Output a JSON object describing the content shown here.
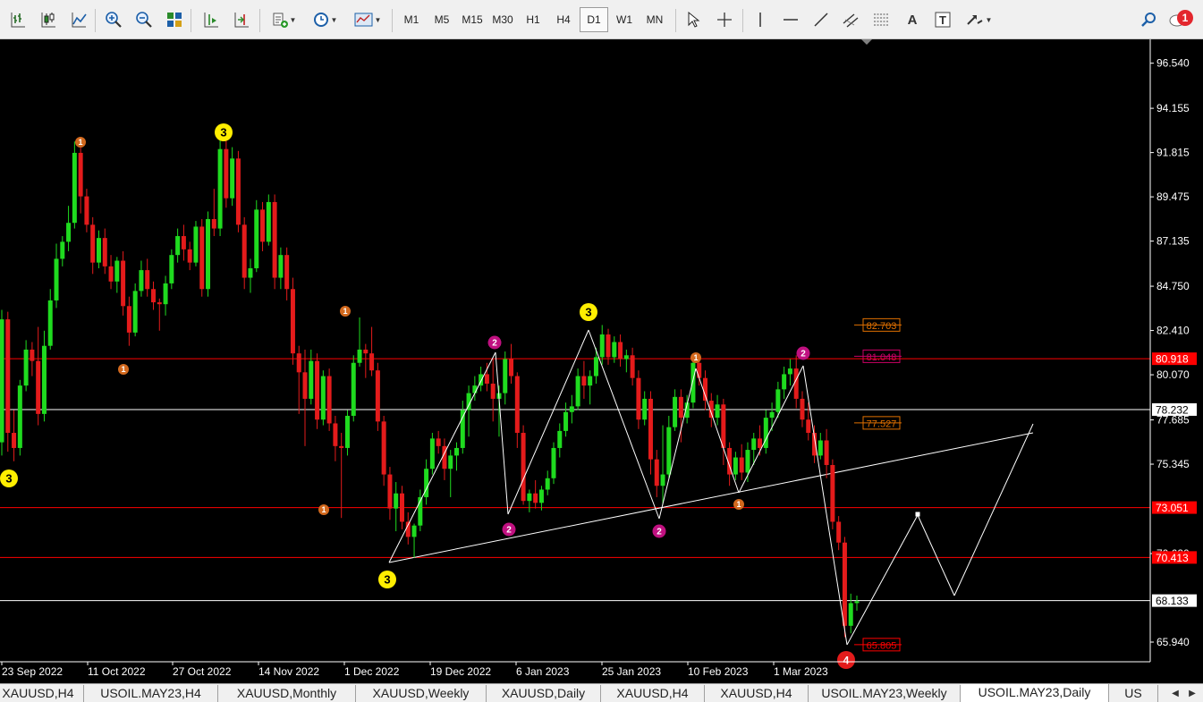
{
  "toolbar": {
    "timeframes": [
      {
        "label": "M1",
        "active": false
      },
      {
        "label": "M5",
        "active": false
      },
      {
        "label": "M15",
        "active": false
      },
      {
        "label": "M30",
        "active": false
      },
      {
        "label": "H1",
        "active": false
      },
      {
        "label": "H4",
        "active": false
      },
      {
        "label": "D1",
        "active": true
      },
      {
        "label": "W1",
        "active": false
      },
      {
        "label": "MN",
        "active": false
      }
    ],
    "notification_count": "1"
  },
  "chart_data": {
    "type": "candlestick",
    "symbol": "USOIL.MAY23",
    "timeframe": "Daily",
    "y_ticks": [
      "96.540",
      "94.155",
      "91.815",
      "89.475",
      "87.135",
      "84.750",
      "82.410",
      "80.070",
      "77.685",
      "75.345",
      "70.620",
      "65.940"
    ],
    "ylim": [
      64.9,
      97.8
    ],
    "x_ticks": [
      "23 Sep 2022",
      "11 Oct 2022",
      "27 Oct 2022",
      "14 Nov 2022",
      "1 Dec 2022",
      "19 Dec 2022",
      "6 Jan 2023",
      "25 Jan 2023",
      "10 Feb 2023",
      "1 Mar 2023"
    ],
    "horizontal_levels": [
      {
        "value": 80.918,
        "label": "80.918",
        "color": "#ff0000"
      },
      {
        "value": 78.232,
        "label": "78.232",
        "color": "#ffffff"
      },
      {
        "value": 73.051,
        "label": "73.051",
        "color": "#ff0000"
      },
      {
        "value": 70.413,
        "label": "70.413",
        "color": "#ff0000"
      },
      {
        "value": 68.133,
        "label": "68.133",
        "color": "#ffffff"
      }
    ],
    "fib_labels": [
      {
        "value": 82.703,
        "label": "82.703",
        "color": "#e07000"
      },
      {
        "value": 81.048,
        "label": "81.048",
        "color": "#cc0066"
      },
      {
        "value": 77.527,
        "label": "77.527",
        "color": "#e07000"
      },
      {
        "value": 65.805,
        "label": "65.805",
        "color": "#ff0000"
      }
    ],
    "wave_labels": [
      {
        "text": "3",
        "style": "big"
      },
      {
        "text": "1",
        "style": "small"
      },
      {
        "text": "3",
        "style": "big"
      },
      {
        "text": "1",
        "style": "small"
      },
      {
        "text": "1",
        "style": "small"
      },
      {
        "text": "1",
        "style": "small"
      },
      {
        "text": "3",
        "style": "big"
      },
      {
        "text": "2",
        "style": "mid"
      },
      {
        "text": "2",
        "style": "mid"
      },
      {
        "text": "3",
        "style": "big"
      },
      {
        "text": "2",
        "style": "mid"
      },
      {
        "text": "1",
        "style": "small"
      },
      {
        "text": "1",
        "style": "small"
      },
      {
        "text": "2",
        "style": "mid"
      },
      {
        "text": "4",
        "style": "red"
      }
    ],
    "candles": [
      {
        "o": 76.5,
        "h": 83.5,
        "l": 75.8,
        "c": 83.0
      },
      {
        "o": 83.0,
        "h": 83.4,
        "l": 76.0,
        "c": 77.0
      },
      {
        "o": 77.0,
        "h": 78.2,
        "l": 75.5,
        "c": 76.2
      },
      {
        "o": 76.2,
        "h": 79.8,
        "l": 75.8,
        "c": 79.5
      },
      {
        "o": 79.5,
        "h": 81.9,
        "l": 79.2,
        "c": 81.4
      },
      {
        "o": 81.4,
        "h": 81.8,
        "l": 80.0,
        "c": 80.8
      },
      {
        "o": 80.8,
        "h": 82.6,
        "l": 77.4,
        "c": 78.0
      },
      {
        "o": 78.0,
        "h": 82.4,
        "l": 77.6,
        "c": 81.6
      },
      {
        "o": 81.6,
        "h": 84.6,
        "l": 81.4,
        "c": 84.0
      },
      {
        "o": 84.0,
        "h": 87.0,
        "l": 83.6,
        "c": 86.2
      },
      {
        "o": 86.2,
        "h": 87.4,
        "l": 85.8,
        "c": 87.1
      },
      {
        "o": 87.1,
        "h": 89.0,
        "l": 86.6,
        "c": 88.1
      },
      {
        "o": 88.1,
        "h": 92.4,
        "l": 87.8,
        "c": 91.8
      },
      {
        "o": 91.8,
        "h": 92.2,
        "l": 88.6,
        "c": 89.5
      },
      {
        "o": 89.5,
        "h": 89.9,
        "l": 87.6,
        "c": 88.0
      },
      {
        "o": 88.0,
        "h": 88.4,
        "l": 85.4,
        "c": 86.0
      },
      {
        "o": 86.0,
        "h": 87.7,
        "l": 85.7,
        "c": 87.3
      },
      {
        "o": 87.3,
        "h": 87.8,
        "l": 85.4,
        "c": 85.8
      },
      {
        "o": 85.8,
        "h": 86.4,
        "l": 84.6,
        "c": 85.0
      },
      {
        "o": 85.0,
        "h": 86.3,
        "l": 84.4,
        "c": 86.1
      },
      {
        "o": 86.1,
        "h": 86.6,
        "l": 83.2,
        "c": 83.7
      },
      {
        "o": 83.7,
        "h": 84.2,
        "l": 81.6,
        "c": 82.3
      },
      {
        "o": 82.3,
        "h": 84.9,
        "l": 82.1,
        "c": 84.5
      },
      {
        "o": 84.5,
        "h": 86.1,
        "l": 84.2,
        "c": 85.6
      },
      {
        "o": 85.6,
        "h": 86.2,
        "l": 84.2,
        "c": 84.6
      },
      {
        "o": 84.6,
        "h": 85.0,
        "l": 83.5,
        "c": 83.9
      },
      {
        "o": 83.9,
        "h": 84.1,
        "l": 82.4,
        "c": 83.8
      },
      {
        "o": 83.8,
        "h": 85.3,
        "l": 83.2,
        "c": 84.9
      },
      {
        "o": 84.9,
        "h": 86.7,
        "l": 84.6,
        "c": 86.4
      },
      {
        "o": 86.4,
        "h": 87.8,
        "l": 86.0,
        "c": 87.4
      },
      {
        "o": 87.4,
        "h": 88.0,
        "l": 86.1,
        "c": 86.7
      },
      {
        "o": 86.7,
        "h": 87.1,
        "l": 85.6,
        "c": 86.0
      },
      {
        "o": 86.0,
        "h": 88.2,
        "l": 85.8,
        "c": 87.9
      },
      {
        "o": 87.9,
        "h": 88.3,
        "l": 84.2,
        "c": 84.6
      },
      {
        "o": 84.6,
        "h": 88.7,
        "l": 84.2,
        "c": 88.3
      },
      {
        "o": 88.3,
        "h": 89.9,
        "l": 87.4,
        "c": 87.8
      },
      {
        "o": 87.8,
        "h": 92.5,
        "l": 87.4,
        "c": 92.0
      },
      {
        "o": 92.0,
        "h": 92.9,
        "l": 88.9,
        "c": 89.4
      },
      {
        "o": 89.4,
        "h": 92.1,
        "l": 89.0,
        "c": 91.5
      },
      {
        "o": 91.5,
        "h": 91.9,
        "l": 87.6,
        "c": 88.0
      },
      {
        "o": 88.0,
        "h": 88.4,
        "l": 84.6,
        "c": 85.2
      },
      {
        "o": 85.2,
        "h": 86.2,
        "l": 84.4,
        "c": 85.7
      },
      {
        "o": 85.7,
        "h": 89.3,
        "l": 85.5,
        "c": 88.8
      },
      {
        "o": 88.8,
        "h": 89.2,
        "l": 86.6,
        "c": 87.1
      },
      {
        "o": 87.1,
        "h": 89.6,
        "l": 86.9,
        "c": 89.2
      },
      {
        "o": 89.2,
        "h": 89.6,
        "l": 84.6,
        "c": 85.2
      },
      {
        "o": 85.2,
        "h": 86.8,
        "l": 84.6,
        "c": 86.4
      },
      {
        "o": 86.4,
        "h": 86.8,
        "l": 84.0,
        "c": 84.6
      },
      {
        "o": 84.6,
        "h": 85.2,
        "l": 80.6,
        "c": 81.2
      },
      {
        "o": 81.2,
        "h": 81.6,
        "l": 78.0,
        "c": 80.2
      },
      {
        "o": 80.2,
        "h": 81.4,
        "l": 76.3,
        "c": 78.8
      },
      {
        "o": 78.8,
        "h": 81.4,
        "l": 78.5,
        "c": 80.8
      },
      {
        "o": 80.8,
        "h": 81.2,
        "l": 77.2,
        "c": 77.7
      },
      {
        "o": 77.7,
        "h": 80.3,
        "l": 77.4,
        "c": 80.0
      },
      {
        "o": 80.0,
        "h": 80.4,
        "l": 77.1,
        "c": 77.5
      },
      {
        "o": 77.5,
        "h": 77.9,
        "l": 75.5,
        "c": 76.3
      },
      {
        "o": 76.3,
        "h": 77.0,
        "l": 72.5,
        "c": 76.2
      },
      {
        "o": 76.2,
        "h": 78.2,
        "l": 75.8,
        "c": 77.9
      },
      {
        "o": 77.9,
        "h": 81.1,
        "l": 77.6,
        "c": 80.7
      },
      {
        "o": 80.7,
        "h": 83.1,
        "l": 80.5,
        "c": 81.4
      },
      {
        "o": 81.4,
        "h": 81.7,
        "l": 79.9,
        "c": 81.2
      },
      {
        "o": 81.2,
        "h": 82.6,
        "l": 80.0,
        "c": 80.3
      },
      {
        "o": 80.3,
        "h": 80.7,
        "l": 77.1,
        "c": 77.6
      },
      {
        "o": 77.6,
        "h": 77.9,
        "l": 74.2,
        "c": 74.8
      },
      {
        "o": 74.8,
        "h": 75.2,
        "l": 72.4,
        "c": 73.0
      },
      {
        "o": 73.0,
        "h": 74.4,
        "l": 71.8,
        "c": 73.8
      },
      {
        "o": 73.8,
        "h": 74.2,
        "l": 71.9,
        "c": 72.3
      },
      {
        "o": 72.3,
        "h": 72.8,
        "l": 71.1,
        "c": 71.5
      },
      {
        "o": 71.5,
        "h": 72.2,
        "l": 70.4,
        "c": 72.1
      },
      {
        "o": 72.1,
        "h": 74.0,
        "l": 71.8,
        "c": 73.6
      },
      {
        "o": 73.6,
        "h": 75.6,
        "l": 73.2,
        "c": 75.1
      },
      {
        "o": 75.1,
        "h": 77.0,
        "l": 74.8,
        "c": 76.7
      },
      {
        "o": 76.7,
        "h": 77.1,
        "l": 75.9,
        "c": 76.3
      },
      {
        "o": 76.3,
        "h": 76.7,
        "l": 74.5,
        "c": 75.1
      },
      {
        "o": 75.1,
        "h": 76.1,
        "l": 73.6,
        "c": 75.8
      },
      {
        "o": 75.8,
        "h": 76.5,
        "l": 75.0,
        "c": 76.2
      },
      {
        "o": 76.2,
        "h": 78.7,
        "l": 75.9,
        "c": 78.2
      },
      {
        "o": 78.2,
        "h": 79.5,
        "l": 76.8,
        "c": 79.1
      },
      {
        "o": 79.1,
        "h": 80.0,
        "l": 78.7,
        "c": 79.5
      },
      {
        "o": 79.5,
        "h": 80.5,
        "l": 79.2,
        "c": 80.1
      },
      {
        "o": 80.1,
        "h": 80.7,
        "l": 79.2,
        "c": 79.6
      },
      {
        "o": 79.6,
        "h": 80.9,
        "l": 77.6,
        "c": 78.8
      },
      {
        "o": 78.8,
        "h": 79.5,
        "l": 76.8,
        "c": 79.1
      },
      {
        "o": 79.1,
        "h": 81.3,
        "l": 78.5,
        "c": 80.9
      },
      {
        "o": 80.9,
        "h": 81.7,
        "l": 79.6,
        "c": 80.0
      },
      {
        "o": 80.0,
        "h": 80.2,
        "l": 76.2,
        "c": 77.0
      },
      {
        "o": 77.0,
        "h": 77.4,
        "l": 73.2,
        "c": 73.4
      },
      {
        "o": 73.4,
        "h": 74.0,
        "l": 72.8,
        "c": 73.8
      },
      {
        "o": 73.8,
        "h": 74.5,
        "l": 73.0,
        "c": 73.3
      },
      {
        "o": 73.3,
        "h": 74.2,
        "l": 72.9,
        "c": 74.0
      },
      {
        "o": 74.0,
        "h": 75.0,
        "l": 73.7,
        "c": 74.6
      },
      {
        "o": 74.6,
        "h": 76.5,
        "l": 74.3,
        "c": 76.2
      },
      {
        "o": 76.2,
        "h": 77.5,
        "l": 75.7,
        "c": 77.1
      },
      {
        "o": 77.1,
        "h": 78.6,
        "l": 76.8,
        "c": 78.1
      },
      {
        "o": 78.1,
        "h": 79.0,
        "l": 77.5,
        "c": 78.4
      },
      {
        "o": 78.4,
        "h": 80.4,
        "l": 78.2,
        "c": 80.0
      },
      {
        "o": 80.0,
        "h": 80.8,
        "l": 78.8,
        "c": 79.5
      },
      {
        "o": 79.5,
        "h": 80.3,
        "l": 78.5,
        "c": 80.0
      },
      {
        "o": 80.0,
        "h": 81.5,
        "l": 79.6,
        "c": 81.0
      },
      {
        "o": 81.0,
        "h": 82.7,
        "l": 80.6,
        "c": 82.2
      },
      {
        "o": 82.2,
        "h": 82.5,
        "l": 80.6,
        "c": 81.0
      },
      {
        "o": 81.0,
        "h": 82.1,
        "l": 80.7,
        "c": 81.8
      },
      {
        "o": 81.8,
        "h": 82.2,
        "l": 80.5,
        "c": 80.9
      },
      {
        "o": 80.9,
        "h": 81.4,
        "l": 80.2,
        "c": 81.1
      },
      {
        "o": 81.1,
        "h": 81.5,
        "l": 79.5,
        "c": 79.9
      },
      {
        "o": 79.9,
        "h": 80.3,
        "l": 77.2,
        "c": 77.7
      },
      {
        "o": 77.7,
        "h": 79.2,
        "l": 77.4,
        "c": 78.8
      },
      {
        "o": 78.8,
        "h": 79.2,
        "l": 74.8,
        "c": 75.6
      },
      {
        "o": 75.6,
        "h": 76.1,
        "l": 73.6,
        "c": 74.2
      },
      {
        "o": 74.2,
        "h": 77.4,
        "l": 73.2,
        "c": 74.8
      },
      {
        "o": 74.8,
        "h": 77.9,
        "l": 74.6,
        "c": 77.3
      },
      {
        "o": 77.3,
        "h": 79.3,
        "l": 77.1,
        "c": 78.9
      },
      {
        "o": 78.9,
        "h": 79.3,
        "l": 76.5,
        "c": 77.8
      },
      {
        "o": 77.8,
        "h": 79.0,
        "l": 77.5,
        "c": 78.6
      },
      {
        "o": 78.6,
        "h": 81.1,
        "l": 78.3,
        "c": 80.7
      },
      {
        "o": 80.7,
        "h": 81.0,
        "l": 79.5,
        "c": 79.9
      },
      {
        "o": 79.9,
        "h": 80.3,
        "l": 78.2,
        "c": 78.7
      },
      {
        "o": 78.7,
        "h": 79.1,
        "l": 77.3,
        "c": 77.8
      },
      {
        "o": 77.8,
        "h": 79.0,
        "l": 77.4,
        "c": 78.5
      },
      {
        "o": 78.5,
        "h": 78.8,
        "l": 75.3,
        "c": 76.2
      },
      {
        "o": 76.2,
        "h": 76.5,
        "l": 74.2,
        "c": 74.8
      },
      {
        "o": 74.8,
        "h": 76.0,
        "l": 74.5,
        "c": 75.7
      },
      {
        "o": 75.7,
        "h": 76.4,
        "l": 74.5,
        "c": 74.9
      },
      {
        "o": 74.9,
        "h": 76.5,
        "l": 74.4,
        "c": 76.1
      },
      {
        "o": 76.1,
        "h": 77.0,
        "l": 75.3,
        "c": 76.7
      },
      {
        "o": 76.7,
        "h": 77.4,
        "l": 75.8,
        "c": 76.2
      },
      {
        "o": 76.2,
        "h": 78.2,
        "l": 75.9,
        "c": 77.8
      },
      {
        "o": 77.8,
        "h": 78.6,
        "l": 77.1,
        "c": 78.1
      },
      {
        "o": 78.1,
        "h": 79.7,
        "l": 77.8,
        "c": 79.3
      },
      {
        "o": 79.3,
        "h": 80.5,
        "l": 78.8,
        "c": 80.1
      },
      {
        "o": 80.1,
        "h": 80.9,
        "l": 79.5,
        "c": 80.4
      },
      {
        "o": 80.4,
        "h": 81.1,
        "l": 78.3,
        "c": 78.8
      },
      {
        "o": 78.8,
        "h": 79.2,
        "l": 77.3,
        "c": 77.7
      },
      {
        "o": 77.7,
        "h": 78.6,
        "l": 76.6,
        "c": 77.0
      },
      {
        "o": 77.0,
        "h": 77.4,
        "l": 75.4,
        "c": 75.8
      },
      {
        "o": 75.8,
        "h": 77.0,
        "l": 75.6,
        "c": 76.6
      },
      {
        "o": 76.6,
        "h": 77.2,
        "l": 74.6,
        "c": 75.3
      },
      {
        "o": 75.3,
        "h": 75.6,
        "l": 71.9,
        "c": 72.3
      },
      {
        "o": 72.3,
        "h": 72.6,
        "l": 70.8,
        "c": 71.2
      },
      {
        "o": 71.2,
        "h": 71.5,
        "l": 66.2,
        "c": 66.8
      },
      {
        "o": 66.8,
        "h": 68.5,
        "l": 66.4,
        "c": 68.0
      },
      {
        "o": 68.0,
        "h": 68.4,
        "l": 67.6,
        "c": 68.1
      }
    ]
  },
  "tabs": [
    {
      "label": "XAUUSD,H4",
      "active": false
    },
    {
      "label": "USOIL.MAY23,H4",
      "active": false
    },
    {
      "label": "XAUUSD,Monthly",
      "active": false
    },
    {
      "label": "XAUUSD,Weekly",
      "active": false
    },
    {
      "label": "XAUUSD,Daily",
      "active": false
    },
    {
      "label": "XAUUSD,H4",
      "active": false
    },
    {
      "label": "XAUUSD,H4",
      "active": false
    },
    {
      "label": "USOIL.MAY23,Weekly",
      "active": false
    },
    {
      "label": "USOIL.MAY23,Daily",
      "active": true
    },
    {
      "label": "US",
      "active": false
    }
  ]
}
